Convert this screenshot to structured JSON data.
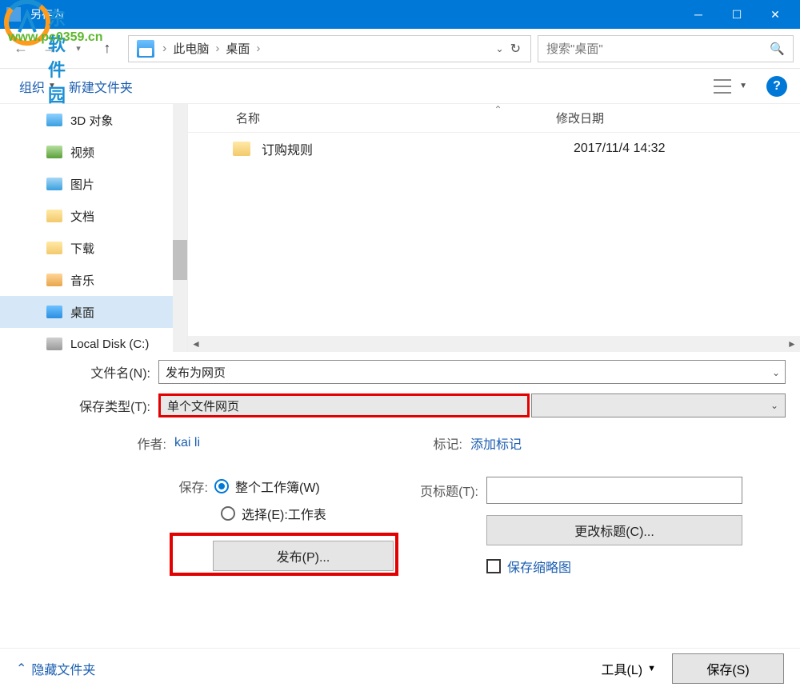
{
  "window": {
    "title": "另存为"
  },
  "watermark": {
    "url": "www.pc0359.cn",
    "logo_text": "东软件园"
  },
  "breadcrumb": {
    "items": [
      "此电脑",
      "桌面"
    ]
  },
  "search": {
    "placeholder": "搜索\"桌面\""
  },
  "toolbar": {
    "organize": "组织",
    "new_folder": "新建文件夹"
  },
  "columns": {
    "name": "名称",
    "modified": "修改日期"
  },
  "sidebar": {
    "items": [
      {
        "label": "3D 对象"
      },
      {
        "label": "视频"
      },
      {
        "label": "图片"
      },
      {
        "label": "文档"
      },
      {
        "label": "下载"
      },
      {
        "label": "音乐"
      },
      {
        "label": "桌面",
        "selected": true
      },
      {
        "label": "Local Disk (C:)"
      }
    ]
  },
  "files": [
    {
      "name": "订购规则",
      "date": "2017/11/4 14:32"
    }
  ],
  "form": {
    "filename_label": "文件名(N):",
    "filename_value": "发布为网页",
    "filetype_label": "保存类型(T):",
    "filetype_value": "单个文件网页",
    "author_label": "作者:",
    "author_value": "kai li",
    "tags_label": "标记:",
    "tags_value": "添加标记",
    "save_label": "保存:",
    "radio_workbook": "整个工作簿(W)",
    "radio_selection": "选择(E):工作表",
    "publish_button": "发布(P)...",
    "page_title_label": "页标题(T):",
    "change_title_button": "更改标题(C)...",
    "save_thumbnail": "保存缩略图"
  },
  "bottom": {
    "hide_folders": "隐藏文件夹",
    "tools": "工具(L)",
    "save": "保存(S)"
  }
}
